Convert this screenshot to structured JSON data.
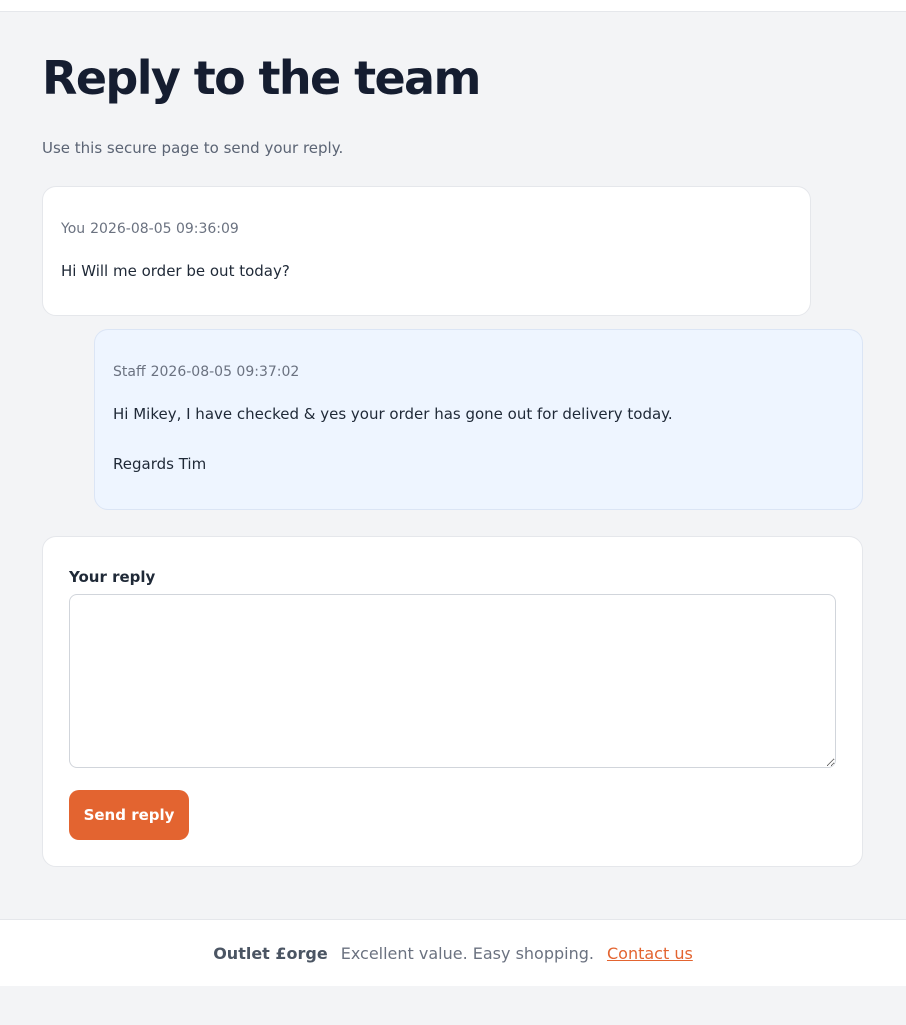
{
  "page": {
    "title": "Reply to the team",
    "subtitle": "Use this secure page to send your reply."
  },
  "messages": [
    {
      "author": "You",
      "timestamp": "2026-08-05 09:36:09",
      "lines": [
        "Hi Will me order be out today?"
      ]
    },
    {
      "author": "Staff",
      "timestamp": "2026-08-05 09:37:02",
      "lines": [
        "Hi Mikey, I have checked & yes your order has gone out for delivery today.",
        "Regards Tim"
      ]
    }
  ],
  "reply_form": {
    "label": "Your reply",
    "value": "",
    "submit_label": "Send reply"
  },
  "footer": {
    "brand": "Outlet £orge",
    "tagline": "Excellent value. Easy shopping.",
    "contact_label": "Contact us"
  },
  "colors": {
    "accent": "#e36430",
    "page_background": "#f3f4f6",
    "staff_message_background": "#eef5ff",
    "heading": "#151d30"
  }
}
